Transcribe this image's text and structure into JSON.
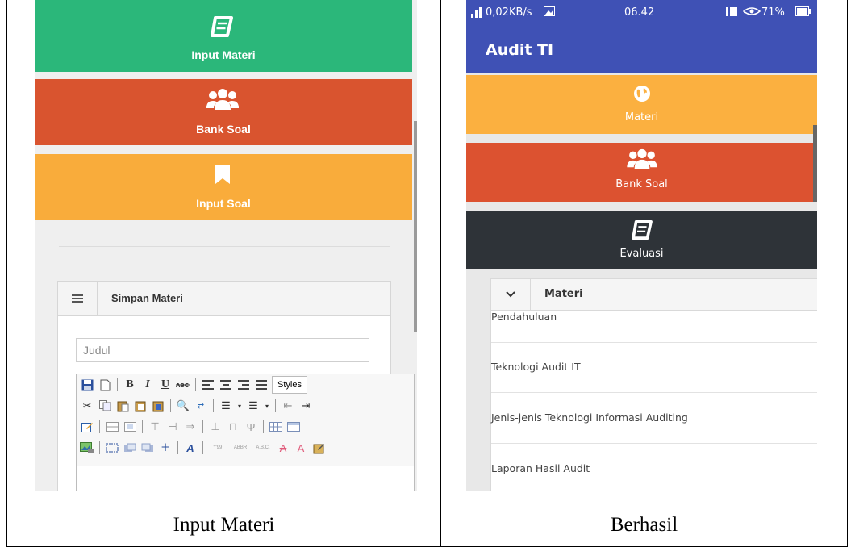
{
  "captions": {
    "left": "Input Materi",
    "right": "Berhasil"
  },
  "left_screen": {
    "tiles": {
      "input_materi": "Input Materi",
      "bank_soal": "Bank Soal",
      "input_soal": "Input Soal"
    },
    "panel": {
      "title": "Simpan Materi",
      "judul_placeholder": "Judul",
      "styles_label": "Styles"
    },
    "colors": {
      "green": "#2bb77a",
      "red": "#d9542f",
      "yellow": "#f9ac3b"
    }
  },
  "right_screen": {
    "status": {
      "network": "0,02KB/s",
      "time": "06.42",
      "battery": "71%"
    },
    "app_title": "Audit TI",
    "tiles": {
      "materi": "Materi",
      "bank_soal": "Bank Soal",
      "evaluasi": "Evaluasi"
    },
    "list": {
      "title": "Materi",
      "items": [
        "Pendahuluan",
        "Teknologi Audit IT",
        "Jenis-jenis Teknologi Informasi Auditing",
        "Laporan Hasil Audit"
      ]
    },
    "colors": {
      "appbar": "#3f51b5",
      "yellow": "#fbb040",
      "red": "#dc5230",
      "dark": "#2e3338"
    }
  }
}
